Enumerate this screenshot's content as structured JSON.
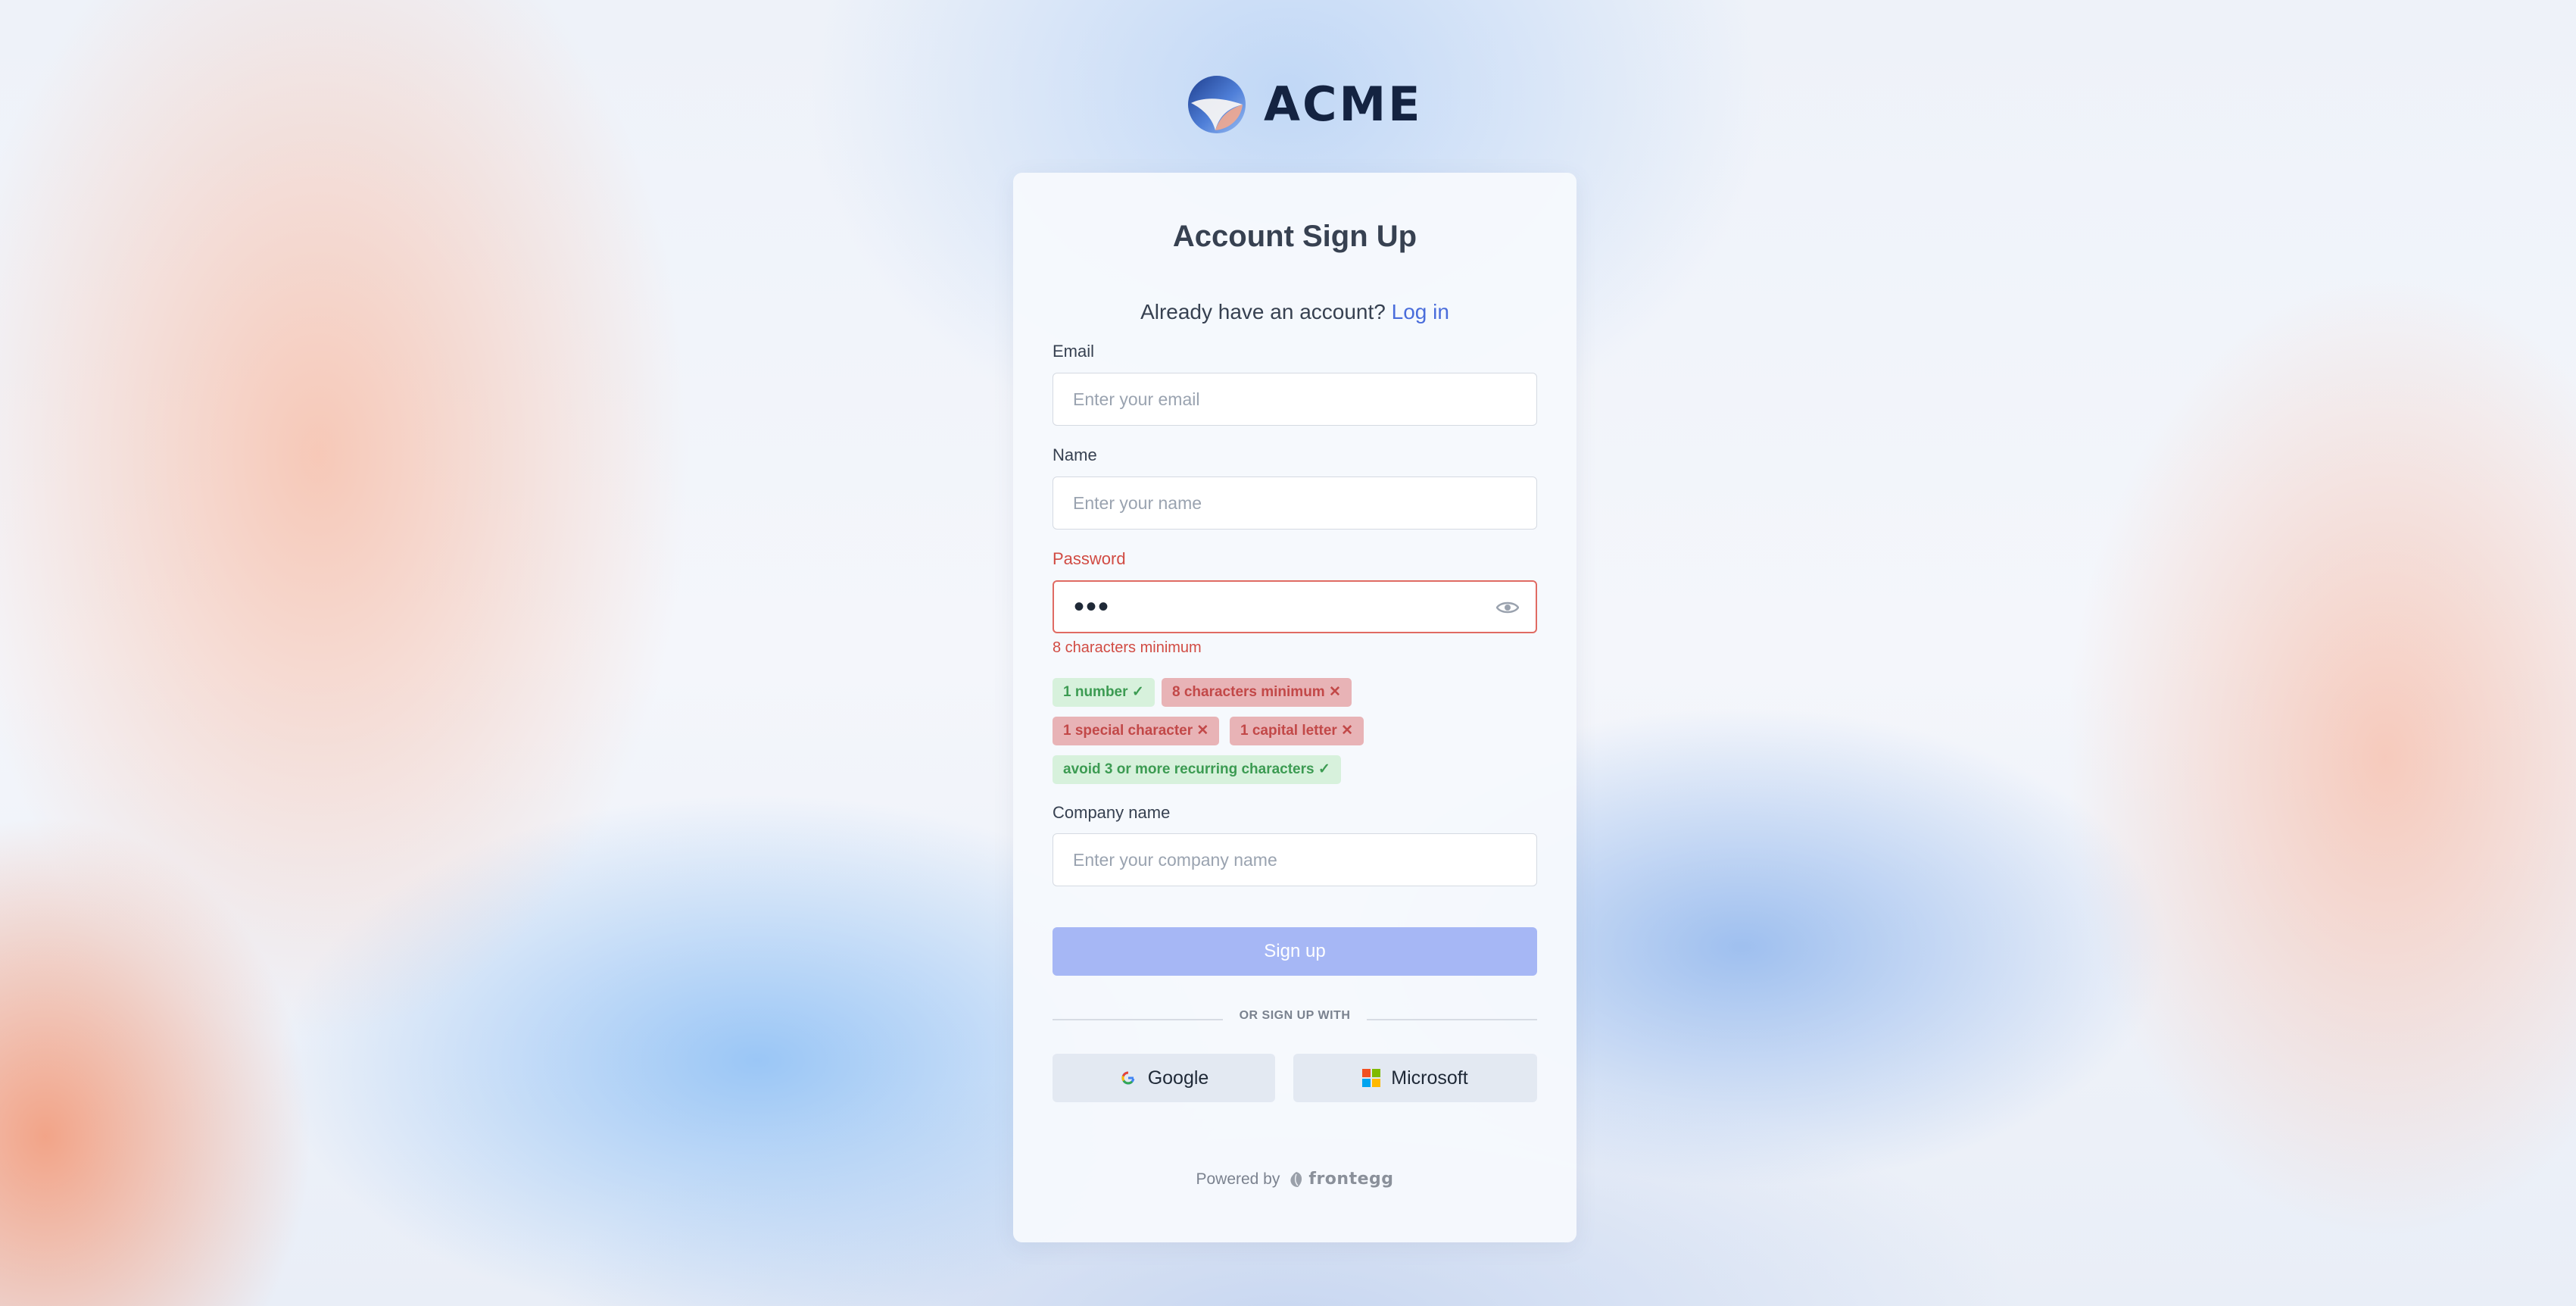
{
  "brand": {
    "name": "ACME"
  },
  "form": {
    "title": "Account Sign Up",
    "login_prompt": "Already have an account?",
    "login_link": "Log in",
    "email": {
      "label": "Email",
      "placeholder": "Enter your email"
    },
    "name": {
      "label": "Name",
      "placeholder": "Enter your name"
    },
    "password": {
      "label": "Password",
      "value": "•••",
      "error": "8 characters minimum"
    },
    "requirements": [
      {
        "label": "1 number",
        "status": "✓"
      },
      {
        "label": "8 characters minimum",
        "status": "✕"
      },
      {
        "label": "1 special character",
        "status": "✕"
      },
      {
        "label": "1 capital letter",
        "status": "✕"
      },
      {
        "label": "avoid 3 or more recurring characters",
        "status": "✓"
      }
    ],
    "company": {
      "label": "Company name",
      "placeholder": "Enter your company name"
    },
    "submit_label": "Sign up",
    "divider_text": "OR SIGN UP WITH",
    "social": {
      "google": "Google",
      "microsoft": "Microsoft"
    }
  },
  "footer": {
    "powered_by": "Powered by",
    "provider": "frontegg"
  },
  "colors": {
    "accent": "#4a6ddb",
    "error": "#d14b43",
    "success": "#3c9b52",
    "button": "#a6b7f5"
  }
}
